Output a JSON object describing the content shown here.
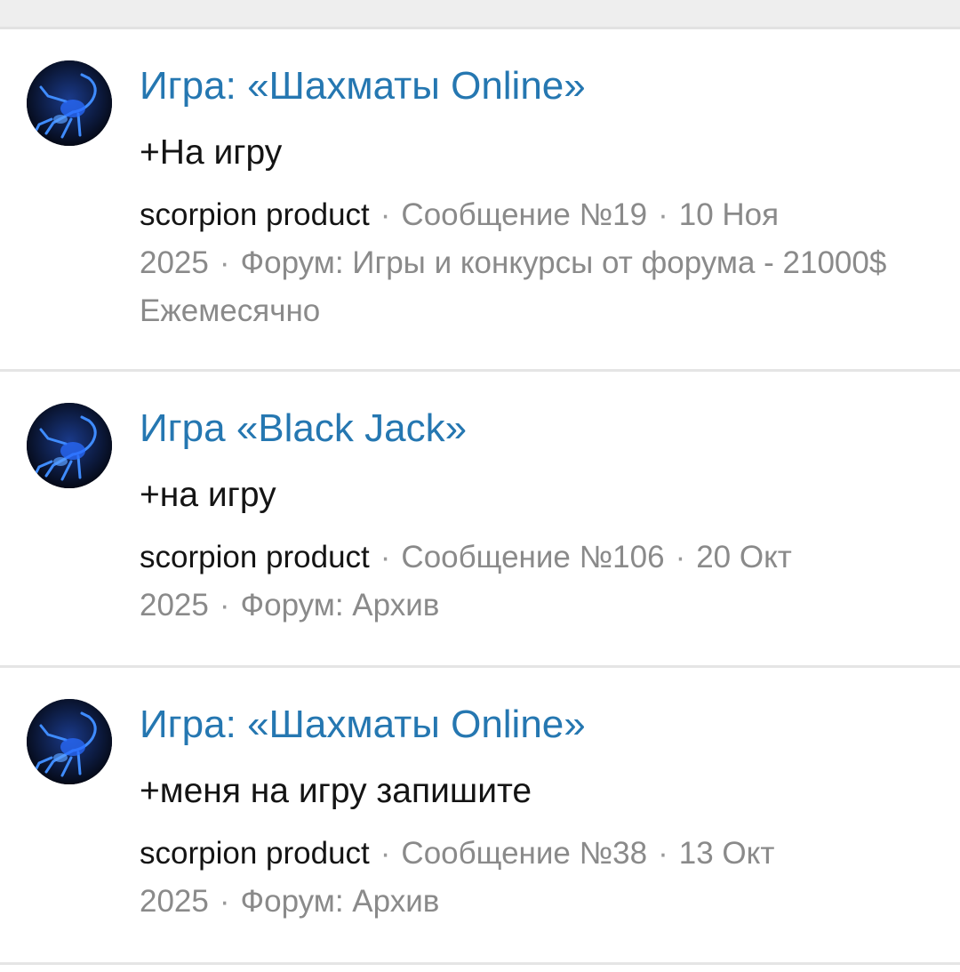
{
  "results": [
    {
      "title": "Игра: «Шахматы Online»",
      "snippet": "+На игру",
      "author": "scorpion product",
      "message": "Сообщение №19",
      "date": "10 Ноя 2025",
      "forum": "Форум: Игры и конкурсы от форума - 21000$ Ежемесячно"
    },
    {
      "title": "Игра «Black Jack»",
      "snippet": "+на игру",
      "author": "scorpion product",
      "message": "Сообщение №106",
      "date": "20 Окт 2025",
      "forum": "Форум: Архив"
    },
    {
      "title": "Игра: «Шахматы Online»",
      "snippet": "+меня на игру запишите",
      "author": "scorpion product",
      "message": "Сообщение №38",
      "date": "13 Окт 2025",
      "forum": "Форум: Архив"
    }
  ],
  "meta_separator": "·",
  "colors": {
    "title_link": "#2577b1",
    "meta_text": "#8a8a8a",
    "body_text": "#141414",
    "avatar_glow": "#2a6cff"
  },
  "avatar_icon": "scorpion-avatar"
}
